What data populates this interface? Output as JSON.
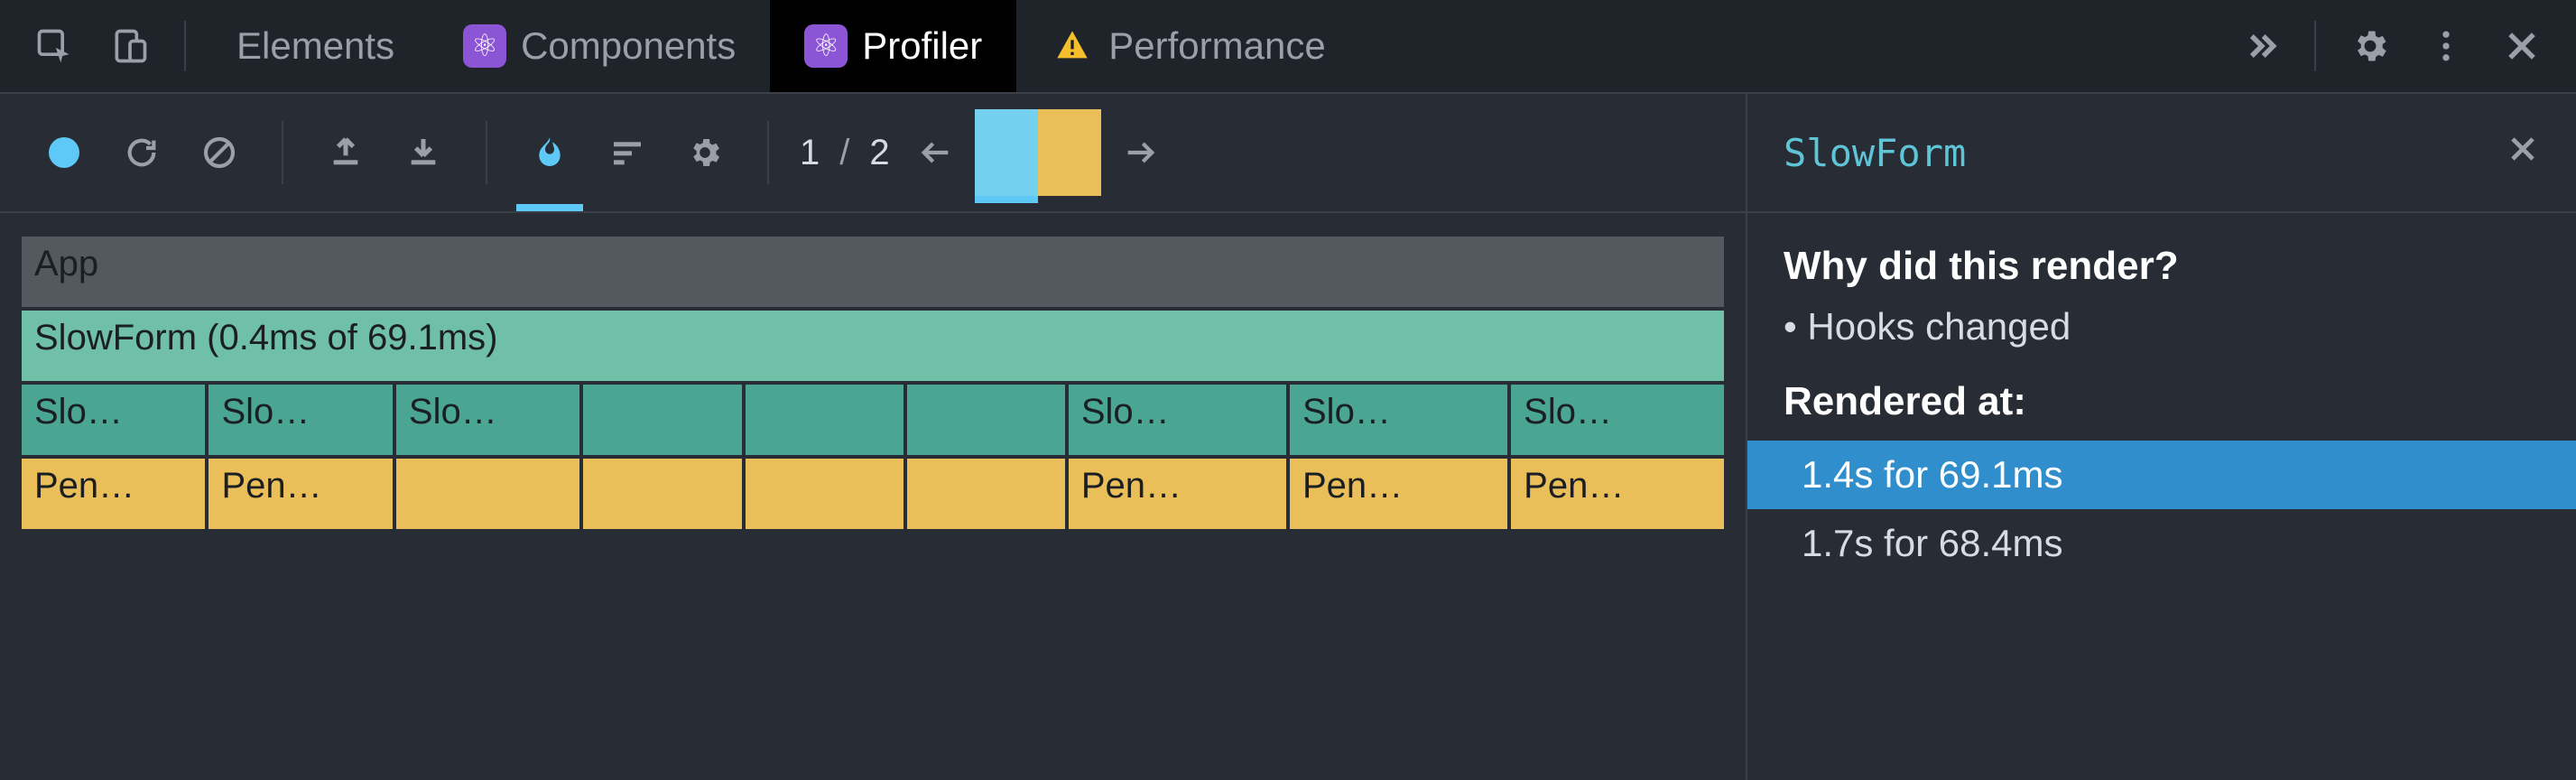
{
  "devtools": {
    "tabs": {
      "elements": "Elements",
      "components": "Components",
      "profiler": "Profiler",
      "performance": "Performance"
    }
  },
  "profiler": {
    "commit_index": "1",
    "commit_sep": "/",
    "commit_total": "2",
    "selected_component": "SlowForm"
  },
  "flame": {
    "row0": {
      "label": "App"
    },
    "row1": {
      "label": "SlowForm (0.4ms of 69.1ms)"
    },
    "row2": {
      "cells": [
        "Slo…",
        "Slo…",
        "Slo…",
        "",
        "",
        "",
        "Slo…",
        "Slo…",
        "Slo…"
      ]
    },
    "row3": {
      "cells": [
        "Pen…",
        "Pen…",
        "",
        "",
        "",
        "",
        "Pen…",
        "Pen…",
        "Pen…"
      ]
    }
  },
  "detail": {
    "why_title": "Why did this render?",
    "why_reason": "Hooks changed",
    "rendered_at_title": "Rendered at",
    "renders": [
      {
        "text": "1.4s for 69.1ms",
        "selected": true
      },
      {
        "text": "1.7s for 68.4ms",
        "selected": false
      }
    ]
  }
}
